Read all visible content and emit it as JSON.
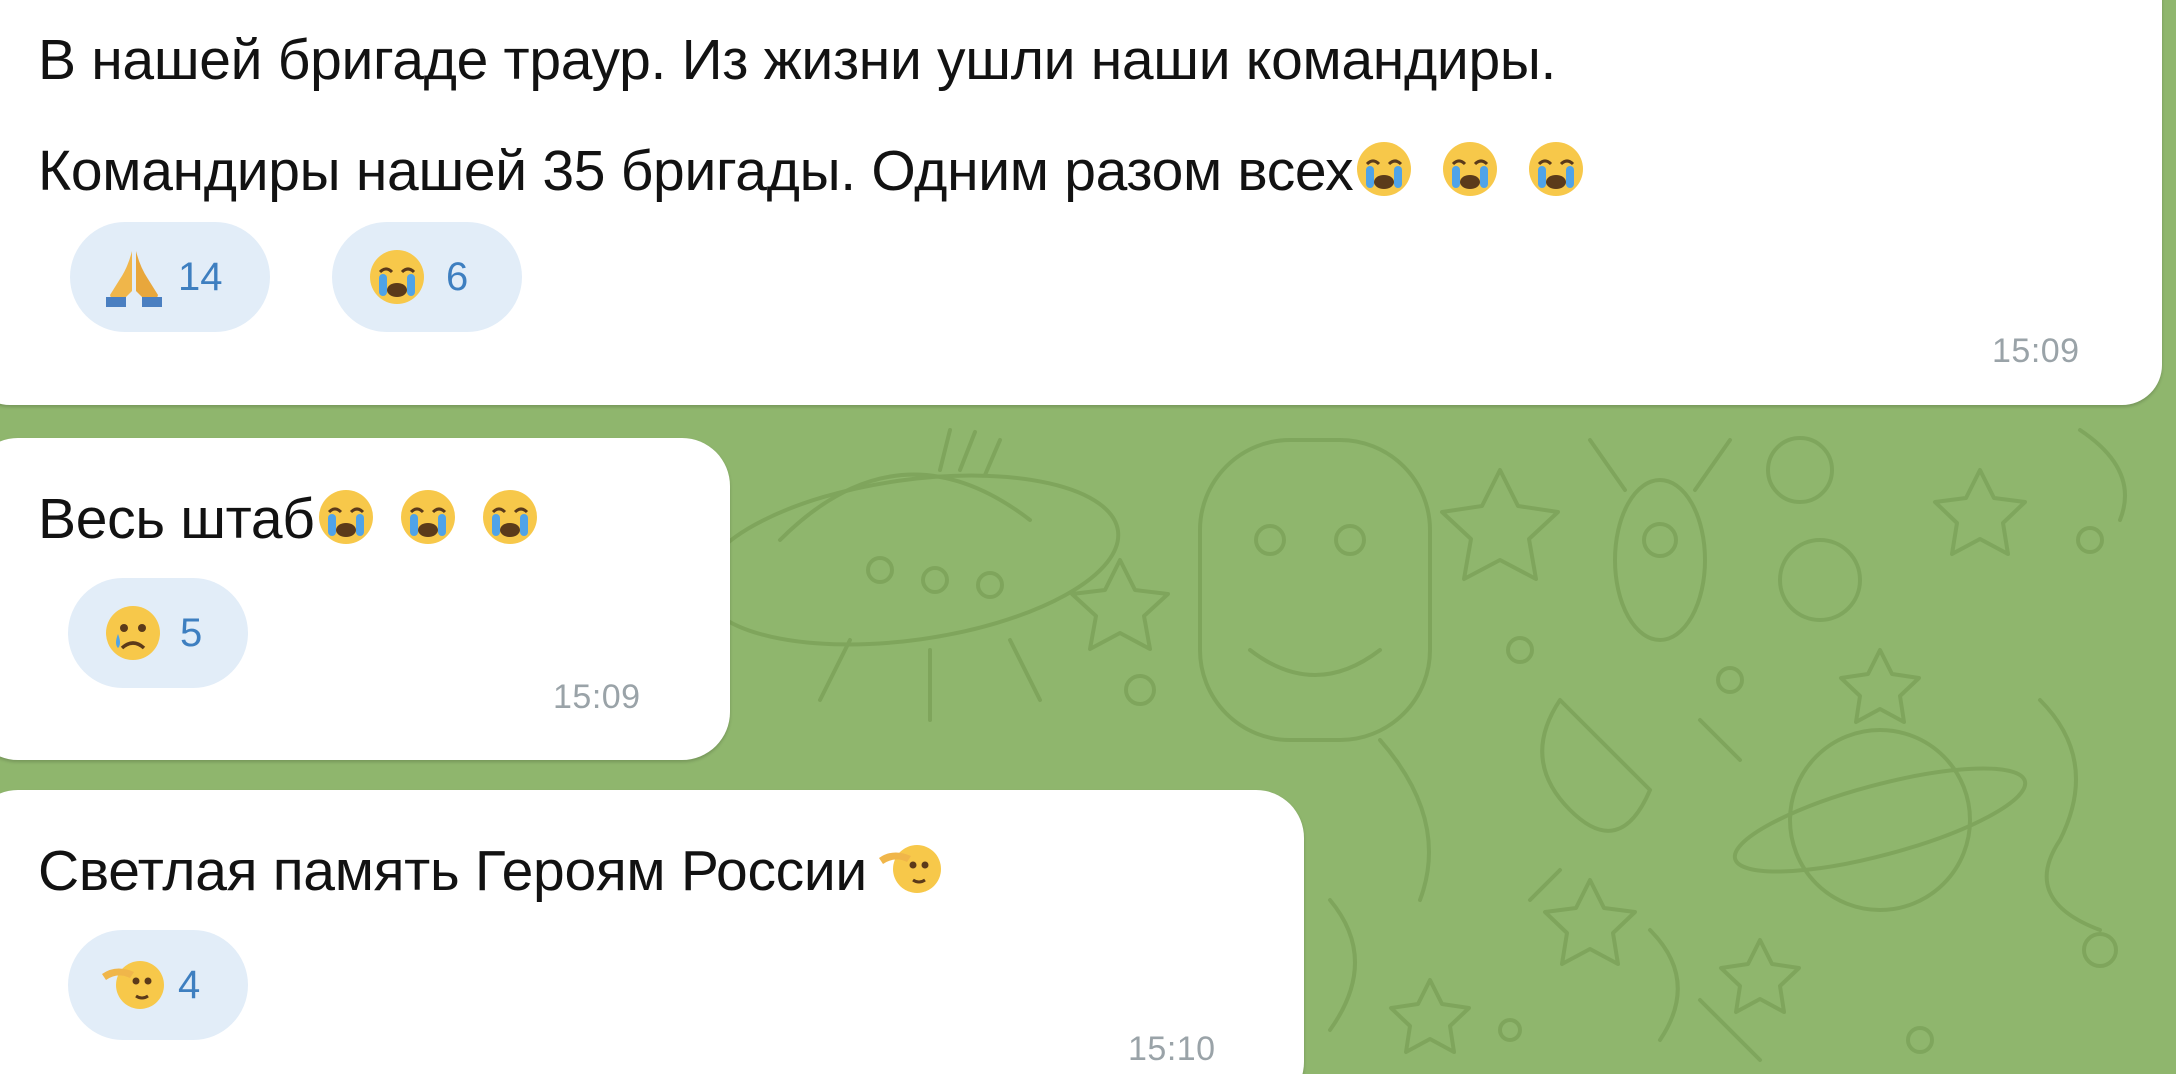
{
  "messages": [
    {
      "text_line1": "В нашей бригаде траур. Из жизни ушли наши командиры.",
      "text_line2": "Командиры нашей 35 бригады. Одним разом всех",
      "trailing_emoji": "crying-face-icon",
      "reactions": [
        {
          "icon": "folded-hands-icon",
          "count": "14"
        },
        {
          "icon": "crying-face-icon",
          "count": "6"
        }
      ],
      "time": "15:09"
    },
    {
      "text": "Весь штаб",
      "trailing_emoji": "crying-face-icon",
      "reactions": [
        {
          "icon": "sad-tear-face-icon",
          "count": "5"
        }
      ],
      "time": "15:09"
    },
    {
      "text": "Светлая память Героям России",
      "trailing_emoji": "saluting-face-icon",
      "reactions": [
        {
          "icon": "saluting-face-icon",
          "count": "4"
        }
      ],
      "time": "15:10"
    }
  ],
  "colors": {
    "chat_background": "#8fb66d",
    "bubble": "#ffffff",
    "reaction_pill": "#e2edf8",
    "reaction_count": "#3e7fc0",
    "timestamp": "#9aa3a8"
  }
}
